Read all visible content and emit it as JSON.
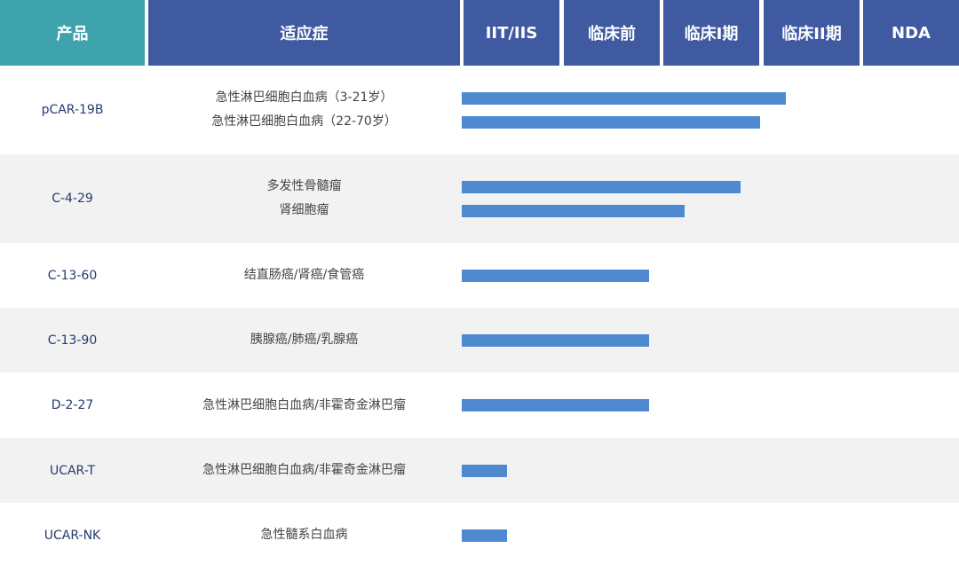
{
  "colors": {
    "product_header": "#3fa3ad",
    "header": "#3f5aa0",
    "bar": "#4f8ad1",
    "row_alt": "#f2f2f2"
  },
  "chart_data": {
    "type": "bar",
    "orientation": "horizontal",
    "headers": {
      "product": "产品",
      "indication": "适应症",
      "stages": [
        "IIT/IIS",
        "临床前",
        "临床I期",
        "临床II期",
        "NDA"
      ]
    },
    "xlim": [
      0,
      5
    ],
    "rows": [
      {
        "product": "pCAR-19B",
        "indications": [
          "急性淋巴细胞白血病（3-21岁）",
          "急性淋巴细胞白血病（22-70岁）"
        ],
        "progress": [
          3.2,
          2.95
        ]
      },
      {
        "product": "C-4-29",
        "indications": [
          "多发性骨髓瘤",
          "肾细胞瘤"
        ],
        "progress": [
          2.75,
          2.2
        ]
      },
      {
        "product": "C-13-60",
        "indications": [
          "结直肠癌/肾癌/食管癌"
        ],
        "progress": [
          1.85
        ]
      },
      {
        "product": "C-13-90",
        "indications": [
          "胰腺癌/肺癌/乳腺癌"
        ],
        "progress": [
          1.85
        ]
      },
      {
        "product": "D-2-27",
        "indications": [
          "急性淋巴细胞白血病/非霍奇金淋巴瘤"
        ],
        "progress": [
          1.85
        ]
      },
      {
        "product": "UCAR-T",
        "indications": [
          "急性淋巴细胞白血病/非霍奇金淋巴瘤"
        ],
        "progress": [
          0.45
        ]
      },
      {
        "product": "UCAR-NK",
        "indications": [
          "急性髓系白血病"
        ],
        "progress": [
          0.45
        ]
      }
    ]
  }
}
